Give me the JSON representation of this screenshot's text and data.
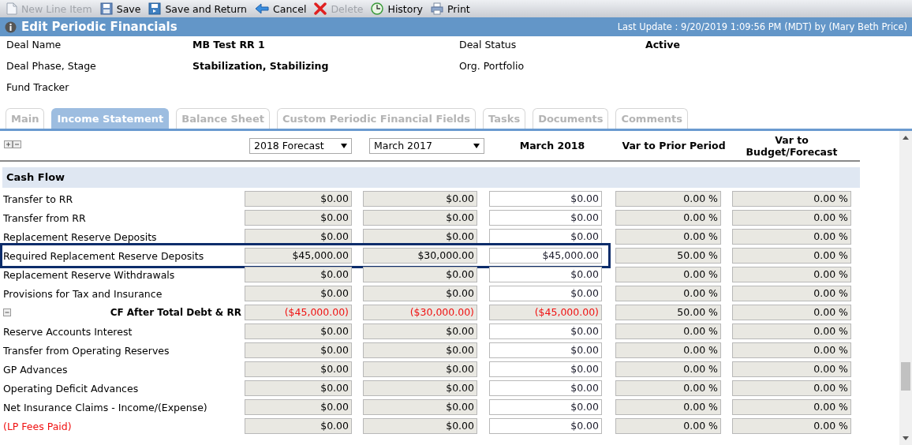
{
  "toolbar": [
    {
      "label": "New Line Item",
      "disabled": true
    },
    {
      "label": "Save",
      "disabled": false
    },
    {
      "label": "Save and Return",
      "disabled": false
    },
    {
      "label": "Cancel",
      "disabled": false
    },
    {
      "label": "Delete",
      "disabled": true
    },
    {
      "label": "History",
      "disabled": false
    },
    {
      "label": "Print",
      "disabled": false
    }
  ],
  "header": {
    "title": "Edit Periodic Financials",
    "last_update": "Last Update : 9/20/2019 1:09:56 PM (MDT) by (Mary Beth Price)"
  },
  "deal_info": [
    {
      "label": "Deal Name",
      "value": "MB Test RR 1"
    },
    {
      "label": "Deal Status",
      "value": "Active"
    },
    {
      "label": "Deal Phase, Stage",
      "value": "Stabilization, Stabilizing"
    },
    {
      "label": "Org. Portfolio"
    },
    {
      "label": "Fund Tracker"
    }
  ],
  "tabs": [
    {
      "label": "Main",
      "selected": false
    },
    {
      "label": "Income Statement",
      "selected": true
    },
    {
      "label": "Balance Sheet",
      "selected": false
    },
    {
      "label": "Custom Periodic Financial Fields",
      "selected": false
    },
    {
      "label": "Tasks",
      "selected": false
    },
    {
      "label": "Documents",
      "selected": false
    },
    {
      "label": "Comments",
      "selected": false
    }
  ],
  "grid": {
    "columns": [
      {
        "kind": "select",
        "value": "2018 Forecast"
      },
      {
        "kind": "select",
        "value": "March 2017"
      },
      {
        "kind": "heading",
        "label": "March 2018"
      },
      {
        "kind": "heading",
        "label": "Var to Prior Period"
      },
      {
        "kind": "heading",
        "label": "Var to Budget/Forecast"
      }
    ],
    "section": "Cash Flow",
    "rows": [
      {
        "kind": "item",
        "label": "Transfer to RR",
        "highlighted": false,
        "values": [
          "$0.00",
          "$0.00",
          "$0.00",
          "0.00 %",
          "0.00 %"
        ]
      },
      {
        "kind": "item",
        "label": "Transfer from RR",
        "highlighted": false,
        "values": [
          "$0.00",
          "$0.00",
          "$0.00",
          "0.00 %",
          "0.00 %"
        ]
      },
      {
        "kind": "item",
        "label": "Replacement Reserve Deposits",
        "highlighted": false,
        "values": [
          "$0.00",
          "$0.00",
          "$0.00",
          "0.00 %",
          "0.00 %"
        ]
      },
      {
        "kind": "item",
        "label": "Required Replacement Reserve Deposits",
        "highlighted": true,
        "values": [
          "$45,000.00",
          "$30,000.00",
          "$45,000.00",
          "50.00 %",
          "0.00 %"
        ]
      },
      {
        "kind": "item",
        "label": "Replacement Reserve Withdrawals",
        "highlighted": false,
        "values": [
          "$0.00",
          "$0.00",
          "$0.00",
          "0.00 %",
          "0.00 %"
        ]
      },
      {
        "kind": "item",
        "label": "Provisions for Tax and Insurance",
        "highlighted": false,
        "values": [
          "$0.00",
          "$0.00",
          "$0.00",
          "0.00 %",
          "0.00 %"
        ]
      },
      {
        "kind": "total",
        "label": "CF After Total Debt & RR",
        "highlighted": false,
        "values": [
          "($45,000.00)",
          "($30,000.00)",
          "($45,000.00)",
          "50.00 %",
          "0.00 %"
        ]
      },
      {
        "kind": "item",
        "label": "Reserve Accounts Interest",
        "highlighted": false,
        "values": [
          "$0.00",
          "$0.00",
          "$0.00",
          "0.00 %",
          "0.00 %"
        ]
      },
      {
        "kind": "item",
        "label": "Transfer from Operating Reserves",
        "highlighted": false,
        "values": [
          "$0.00",
          "$0.00",
          "$0.00",
          "0.00 %",
          "0.00 %"
        ]
      },
      {
        "kind": "item",
        "label": "GP Advances",
        "highlighted": false,
        "values": [
          "$0.00",
          "$0.00",
          "$0.00",
          "0.00 %",
          "0.00 %"
        ]
      },
      {
        "kind": "item",
        "label": "Operating Deficit Advances",
        "highlighted": false,
        "values": [
          "$0.00",
          "$0.00",
          "$0.00",
          "0.00 %",
          "0.00 %"
        ]
      },
      {
        "kind": "item",
        "label": "Net Insurance Claims - Income/(Expense)",
        "highlighted": false,
        "values": [
          "$0.00",
          "$0.00",
          "$0.00",
          "0.00 %",
          "0.00 %"
        ]
      },
      {
        "kind": "deduction",
        "label": "(LP Fees Paid)",
        "highlighted": false,
        "values": [
          "$0.00",
          "$0.00",
          "$0.00",
          "0.00 %",
          "0.00 %"
        ]
      }
    ]
  }
}
